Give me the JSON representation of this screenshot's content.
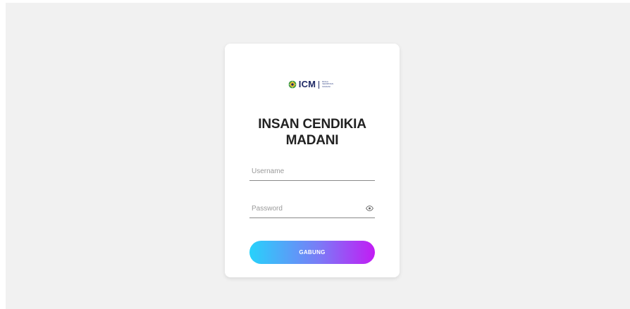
{
  "logo": {
    "icon": "icm-emblem",
    "text": "ICM",
    "tagline": "BOGA\nSEMPATAN\nMADANI"
  },
  "title": {
    "line1": "INSAN CENDIKIA",
    "line2": "MADANI"
  },
  "form": {
    "username_placeholder": "Username",
    "password_placeholder": "Password",
    "toggle_icon": "eye-icon",
    "submit_label": "GABUNG"
  },
  "colors": {
    "page_background": "#f1f1f1",
    "card_background": "#ffffff",
    "button_gradient_start": "#27d2fb",
    "button_gradient_end": "#c21cf4",
    "brand": "#1f2a66"
  }
}
